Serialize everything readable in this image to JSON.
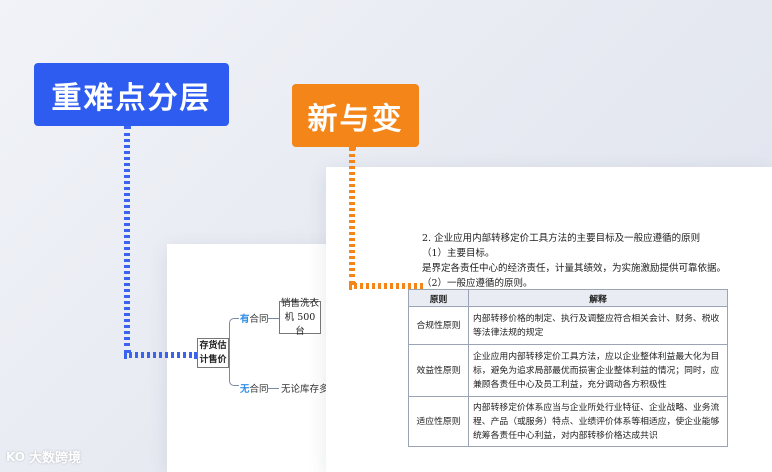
{
  "tags": {
    "blue": "重难点分层",
    "orange": "新与变"
  },
  "mindmap": {
    "root": "存货估计售价",
    "branch_yes_key": "有",
    "branch_yes_rest": "合同",
    "branch_yes_node": "销售洗衣机 500 台",
    "branch_no_key": "无",
    "branch_no_rest": "合同",
    "branch_no_text": "无论库存多少"
  },
  "document": {
    "heading": "2. 企业应用内部转移定价工具方法的主要目标及一般应遵循的原则",
    "item1": "（1）主要目标。",
    "line1": "是界定各责任中心的经济责任，计量其绩效，为实施激励提供可靠依据。",
    "item2": "（2）一般应遵循的原则。",
    "table": {
      "headers": [
        "原则",
        "解释"
      ],
      "rows": [
        {
          "principle": "合规性原则",
          "explanation": "内部转移价格的制定、执行及调整应符合相关会计、财务、税收等法律法规的规定"
        },
        {
          "principle": "效益性原则",
          "explanation": "企业应用内部转移定价工具方法，应以企业整体利益最大化为目标，避免为追求局部最优而损害企业整体利益的情况；同时，应兼顾各责任中心及员工利益，充分调动各方积极性"
        },
        {
          "principle": "适应性原则",
          "explanation": "内部转移定价体系应当与企业所处行业特征、企业战略、业务流程、产品（或服务）特点、业绩评价体系等相适应，使企业能够统筹各责任中心利益，对内部转移价格达成共识"
        }
      ]
    }
  },
  "watermark": {
    "mark": "KO",
    "text": "大数跨境"
  },
  "colors": {
    "blue": "#2f5cf0",
    "orange": "#f38519"
  }
}
